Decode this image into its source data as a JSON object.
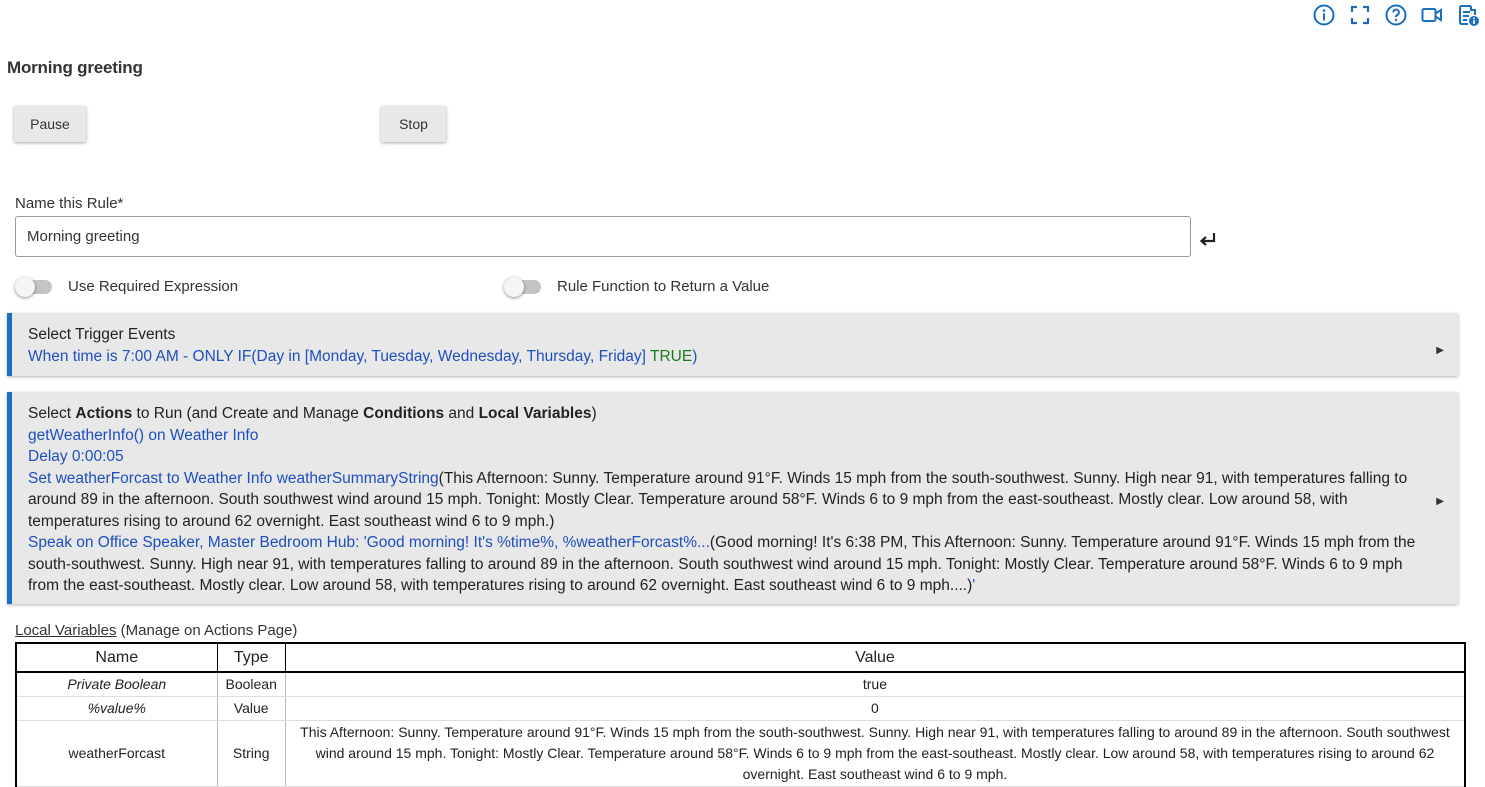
{
  "header_icons": [
    {
      "icon": "info-icon"
    },
    {
      "icon": "fullscreen-icon"
    },
    {
      "icon": "help-icon"
    },
    {
      "icon": "video-icon"
    },
    {
      "icon": "logs-icon"
    }
  ],
  "page": {
    "title": "Morning greeting"
  },
  "controls": {
    "pause_label": "Pause",
    "stop_label": "Stop"
  },
  "name_field": {
    "label": "Name this Rule*",
    "value": "Morning greeting"
  },
  "toggles": {
    "required_expression": {
      "label": "Use Required Expression",
      "on": false
    },
    "rule_function": {
      "label": "Rule Function to Return a Value",
      "on": false
    }
  },
  "trigger_panel": {
    "title": "Select Trigger Events",
    "summary_blue": "When time is 7:00 AM - ONLY IF(Day in [Monday, Tuesday, Wednesday, Thursday, Friday] ",
    "summary_green": "TRUE",
    "summary_close": ")"
  },
  "actions_panel": {
    "title_1": "Select ",
    "title_2": "Actions",
    "title_3": " to Run (and Create and Manage ",
    "title_4": "Conditions",
    "title_5": " and ",
    "title_6": "Local Variables",
    "title_7": ")",
    "action_1": "getWeatherInfo() on Weather Info",
    "action_2": "Delay 0:00:05",
    "action_3_blue": "Set weatherForcast to Weather Info weatherSummaryString",
    "action_3_dark": "(This Afternoon: Sunny. Temperature around 91°F. Winds 15 mph from the south-southwest. Sunny. High near 91, with temperatures falling to around 89 in the afternoon. South southwest wind around 15 mph. Tonight: Mostly Clear. Temperature around 58°F. Winds 6 to 9 mph from the east-southeast. Mostly clear. Low around 58, with temperatures rising to around 62 overnight. East southeast wind 6 to 9 mph.)",
    "action_4_blue": "Speak on Office Speaker, Master Bedroom Hub: 'Good morning! It's %time%, %weatherForcast%...",
    "action_4_dark": "(Good morning! It's 6:38 PM, This Afternoon: Sunny. Temperature around 91°F. Winds 15 mph from the south-southwest. Sunny. High near 91, with temperatures falling to around 89 in the afternoon. South southwest wind around 15 mph. Tonight: Mostly Clear. Temperature around 58°F. Winds 6 to 9 mph from the east-southeast. Mostly clear. Low around 58, with temperatures rising to around 62 overnight. East southeast wind 6 to 9 mph....)",
    "action_4_end": "'"
  },
  "local_variables": {
    "label": "Local Variables",
    "sublabel": " (Manage on Actions Page)",
    "columns": {
      "name": "Name",
      "type": "Type",
      "value": "Value"
    },
    "rows": [
      {
        "name": "Private Boolean",
        "type": "Boolean",
        "value": "true"
      },
      {
        "name": "%value%",
        "type": "Value",
        "value": "0"
      },
      {
        "name": "weatherForcast",
        "type": "String",
        "value": "This Afternoon: Sunny. Temperature around 91°F. Winds 15 mph from the south-southwest. Sunny. High near 91, with temperatures falling to around 89 in the afternoon. South southwest wind around 15 mph. Tonight: Mostly Clear. Temperature around 58°F. Winds 6 to 9 mph from the east-southeast. Mostly clear. Low around 58, with temperatures rising to around 62 overnight. East southeast wind 6 to 9 mph."
      }
    ]
  },
  "colors": {
    "accent": "#1a6fbf",
    "link": "#1d4fbd",
    "true": "#1a7a1a",
    "panel_bg": "#e8e8e8"
  }
}
